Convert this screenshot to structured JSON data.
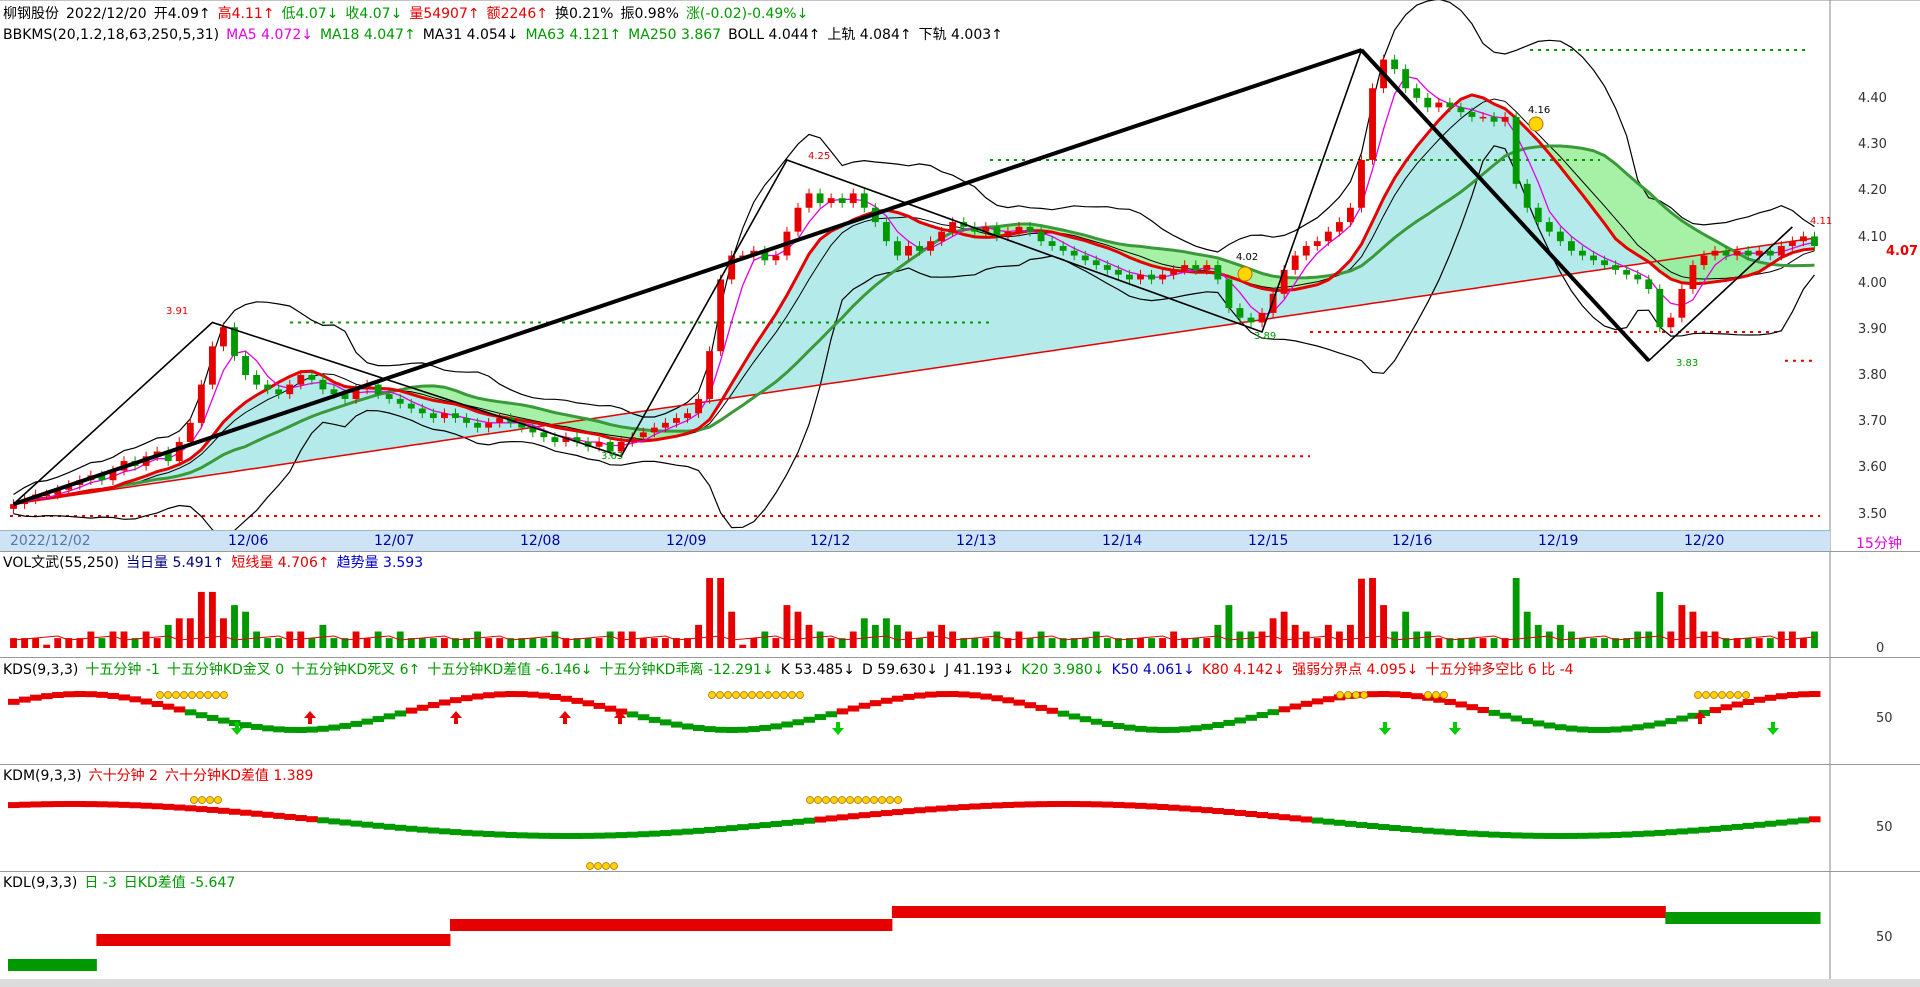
{
  "header": {
    "name": "柳钢股份",
    "date": "2022/12/20",
    "open": "开4.09↑",
    "high": "高4.11↑",
    "low": "低4.07↓",
    "close": "收4.07↓",
    "volume": "量54907↑",
    "amount": "额2246↑",
    "turnover": "换0.21%",
    "amplitude": "振0.98%",
    "change": "涨(-0.02)-0.49%↓"
  },
  "indicator_line": {
    "name": "BBKMS(20,1.2,18,63,250,5,31)",
    "ma5": "MA5 4.072↓",
    "ma18": "MA18 4.047↑",
    "ma31": "MA31 4.054↓",
    "ma63": "MA63 4.121↑",
    "ma250": "MA250 3.867",
    "boll": "BOLL 4.044↑",
    "upper": "上轨 4.084↑",
    "lower": "下轨 4.003↑"
  },
  "price_axis": {
    "ticks": [
      "4.40",
      "4.30",
      "4.20",
      "4.10",
      "4.00",
      "3.90",
      "3.80",
      "3.70",
      "3.60",
      "3.50"
    ],
    "current": "4.07"
  },
  "dates": [
    "2022/12/02",
    "12/06",
    "12/07",
    "12/08",
    "12/09",
    "12/12",
    "12/13",
    "12/14",
    "12/15",
    "12/16",
    "12/19",
    "12/20"
  ],
  "period": "15分钟",
  "annotations": {
    "a391": "3.91",
    "a425": "4.25",
    "a416": "4.16",
    "a411": "4.11",
    "a363": "3.63",
    "a389": "3.89",
    "a383": "3.83",
    "a402": "4.02"
  },
  "vol_panel": {
    "name": "VOL文武(55,250)",
    "day": "当日量 5.491↑",
    "short": "短线量 4.706↑",
    "trend": "趋势量 3.593",
    "axis": "0"
  },
  "kds_panel": {
    "name": "KDS(9,3,3)",
    "items": [
      "十五分钟 -1",
      "十五分钟KD金叉 0",
      "十五分钟KD死叉 6↑",
      "十五分钟KD差值 -6.146↓",
      "十五分钟KD乖离 -12.291↓",
      "K 53.485↓",
      "D 59.630↓",
      "J 41.193↓",
      "K20 3.980↓",
      "K50 4.061↓",
      "K80 4.142↓",
      "强弱分界点 4.095↓",
      "十五分钟多空比 6 比 -4"
    ],
    "axis": "50"
  },
  "kdm_panel": {
    "name": "KDM(9,3,3)",
    "items": [
      "六十分钟 2",
      "六十分钟KD差值 1.389"
    ],
    "axis": "50"
  },
  "kdl_panel": {
    "name": "KDL(9,3,3)",
    "items": [
      "日 -3",
      "日KD差值 -5.647"
    ],
    "axis": "50"
  },
  "colors": {
    "up": "#e60000",
    "down": "#009900",
    "ma5": "#e600e6",
    "boll": "#000000",
    "fill_cyan": "#a8e6e6",
    "fill_green": "#90ee90",
    "ma63": "#3a9a3a",
    "ma250": "#e60000"
  },
  "chart_data": {
    "type": "candlestick",
    "title": "柳钢股份 2022/12/20",
    "ylim": [
      3.48,
      4.48
    ],
    "xlabel": "",
    "ylabel": "",
    "categories": [
      "2022/12/02",
      "12/06",
      "12/07",
      "12/08",
      "12/09",
      "12/12",
      "12/13",
      "12/14",
      "12/15",
      "12/16",
      "12/19",
      "12/20"
    ],
    "close_series": [
      3.53,
      3.54,
      3.55,
      3.55,
      3.56,
      3.57,
      3.58,
      3.59,
      3.58,
      3.6,
      3.62,
      3.61,
      3.63,
      3.64,
      3.62,
      3.66,
      3.7,
      3.78,
      3.86,
      3.9,
      3.84,
      3.8,
      3.78,
      3.77,
      3.76,
      3.78,
      3.8,
      3.79,
      3.77,
      3.76,
      3.75,
      3.77,
      3.78,
      3.76,
      3.75,
      3.74,
      3.73,
      3.72,
      3.71,
      3.72,
      3.71,
      3.7,
      3.69,
      3.7,
      3.71,
      3.7,
      3.69,
      3.68,
      3.67,
      3.66,
      3.67,
      3.66,
      3.65,
      3.66,
      3.64,
      3.66,
      3.67,
      3.68,
      3.69,
      3.7,
      3.71,
      3.72,
      3.75,
      3.85,
      4.0,
      4.05,
      4.05,
      4.06,
      4.04,
      4.05,
      4.1,
      4.15,
      4.18,
      4.16,
      4.17,
      4.16,
      4.18,
      4.15,
      4.12,
      4.08,
      4.05,
      4.07,
      4.06,
      4.08,
      4.1,
      4.12,
      4.11,
      4.1,
      4.11,
      4.09,
      4.1,
      4.11,
      4.1,
      4.08,
      4.07,
      4.06,
      4.05,
      4.04,
      4.03,
      4.02,
      4.01,
      4.0,
      4.01,
      4.0,
      4.01,
      4.02,
      4.03,
      4.02,
      4.03,
      4.0,
      3.94,
      3.92,
      3.91,
      3.93,
      3.97,
      4.02,
      4.05,
      4.07,
      4.08,
      4.1,
      4.12,
      4.15,
      4.25,
      4.4,
      4.46,
      4.44,
      4.4,
      4.38,
      4.36,
      4.37,
      4.36,
      4.35,
      4.34,
      4.34,
      4.33,
      4.34,
      4.2,
      4.15,
      4.12,
      4.1,
      4.08,
      4.06,
      4.05,
      4.04,
      4.03,
      4.02,
      4.01,
      4.0,
      3.98,
      3.9,
      3.92,
      3.98,
      4.03,
      4.05,
      4.06,
      4.05,
      4.06,
      4.05,
      4.06,
      4.05,
      4.07,
      4.08,
      4.09,
      4.07
    ]
  }
}
